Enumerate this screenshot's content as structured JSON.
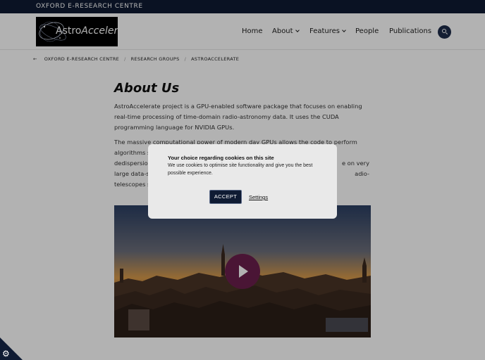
{
  "topbar": {
    "title": "OXFORD E-RESEARCH CENTRE"
  },
  "logo": {
    "part1": "Astro",
    "part2": "Accelerate"
  },
  "nav": {
    "items": [
      {
        "label": "Home"
      },
      {
        "label": "About"
      },
      {
        "label": "Features"
      },
      {
        "label": "People"
      },
      {
        "label": "Publications"
      }
    ],
    "search_icon": "search-icon"
  },
  "breadcrumb": {
    "back_icon": "←",
    "items": [
      "OXFORD E-RESEARCH CENTRE",
      "RESEARCH GROUPS",
      "ASTROACCELERATE"
    ]
  },
  "main": {
    "title": "About Us",
    "para1": "AstroAccelerate project is a GPU-enabled software package that focuses on enabling real-time processing of time-domain radio-astronomy data. It uses the CUDA programming language for NVIDIA GPUs.",
    "para2_line1": "The massive computational power of modern day GPUs allows the code to perform algorithms such as",
    "para2_line2_start": "dedispersion,",
    "para2_line2_end": "e on very",
    "para2_line3_start": "large data-set",
    "para2_line3_end": "adio-",
    "para2_line4_start": "telescopes su"
  },
  "cookie": {
    "title": "Your choice regarding cookies on this site",
    "text": "We use cookies to optimise site functionality and give you the best possible experience.",
    "accept_label": "ACCEPT",
    "settings_label": "Settings",
    "corner_icon": "⚙"
  },
  "colors": {
    "navy": "#0f1b33",
    "play": "#6a1f4d"
  }
}
